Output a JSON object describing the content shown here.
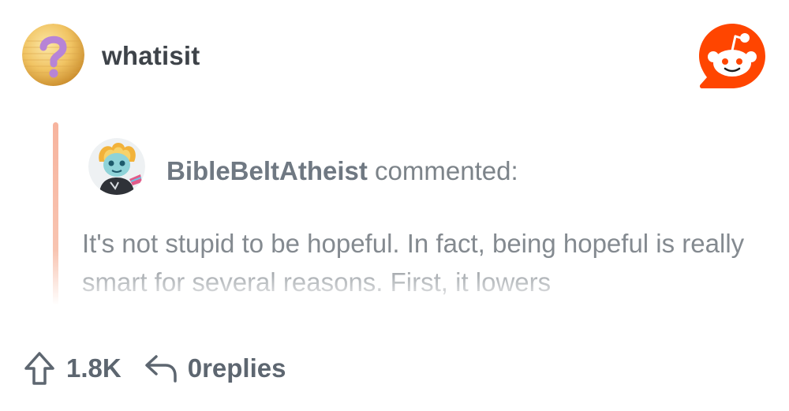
{
  "post": {
    "community": "whatisit",
    "community_icon": "question-mark-coin-icon",
    "brand_icon": "reddit-snoo-icon",
    "brand_color": "#ff4500"
  },
  "comment": {
    "author": "BibleBeltAtheist",
    "verb": "commented:",
    "body": "It's not stupid to be hopeful. In fact, being hopeful is really smart for several reasons. First, it lowers"
  },
  "footer": {
    "score": "1.8K",
    "replies_count": "0",
    "replies_label": "replies"
  },
  "colors": {
    "quote_bar": "#f7b49e",
    "text_muted": "#848a90",
    "title_text": "#3e4349"
  }
}
